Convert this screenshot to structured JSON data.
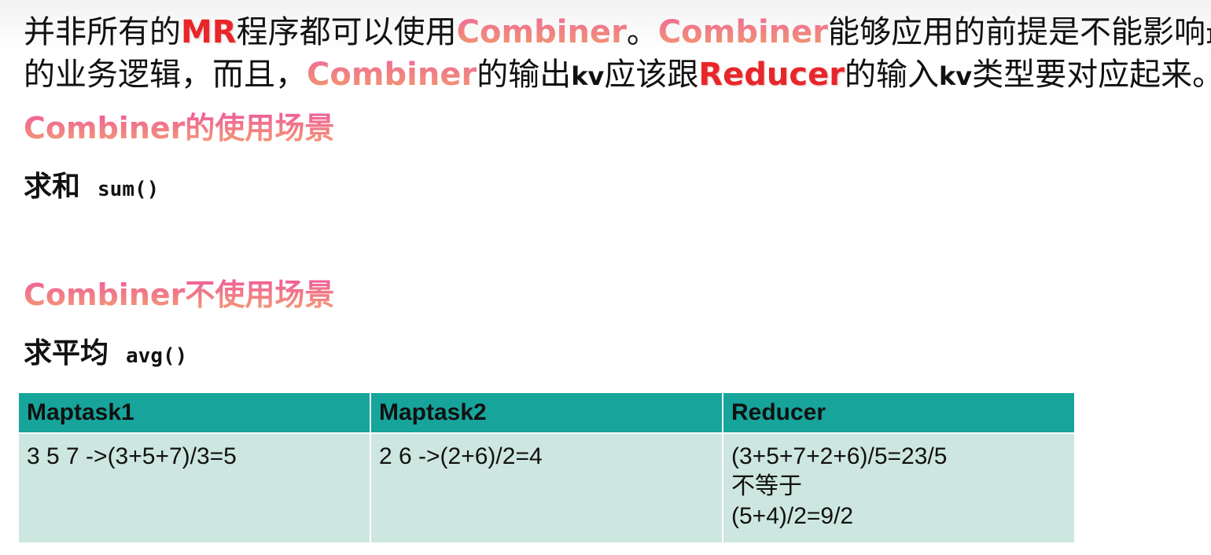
{
  "intro": {
    "line1": {
      "t1": "并非所有的",
      "kw_mr": "MR",
      "t2": "程序都可以使用",
      "kw_combiner1": "Combiner",
      "t3": "。",
      "kw_combiner2": "Combiner",
      "t4": "能够应用的前提是不能影响最终"
    },
    "line2": {
      "t1": "的业务逻辑，而且，",
      "kw_combiner": "Combiner",
      "t2": "的输出",
      "kw_kv1": "kv",
      "t3": "应该跟",
      "kw_reducer": "Reducer",
      "t4": "的输入",
      "kw_kv2": "kv",
      "t5": "类型要对应起来。"
    }
  },
  "use_section": {
    "heading": "Combiner的使用场景",
    "example_label": "求和",
    "example_fn": "sum()"
  },
  "no_use_section": {
    "heading": "Combiner不使用场景",
    "example_label": "求平均",
    "example_fn": "avg()"
  },
  "table": {
    "headers": [
      "Maptask1",
      "Maptask2",
      "Reducer"
    ],
    "cells": {
      "maptask1": "3 5 7 ->(3+5+7)/3=5",
      "maptask2": "2 6 ->(2+6)/2=4",
      "reducer_line1": "(3+5+7+2+6)/5=23/5",
      "reducer_line2": "不等于",
      "reducer_line3": "(5+4)/2=9/2"
    }
  },
  "colors": {
    "keyword_red": "#e8262a",
    "keyword_pink_start": "#ee5a9a",
    "keyword_pink_end": "#f39e73",
    "table_header": "#17a49b",
    "table_body": "#cde6e0"
  }
}
